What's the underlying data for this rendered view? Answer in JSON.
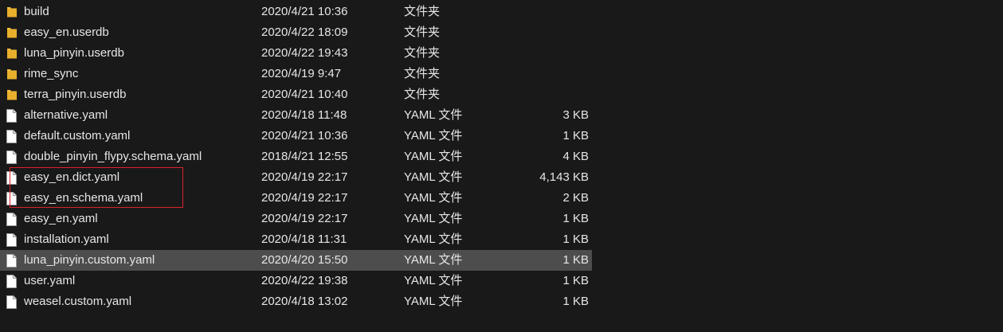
{
  "files": [
    {
      "name": "build",
      "date": "2020/4/21 10:36",
      "type": "文件夹",
      "size": "",
      "kind": "folder"
    },
    {
      "name": "easy_en.userdb",
      "date": "2020/4/22 18:09",
      "type": "文件夹",
      "size": "",
      "kind": "folder"
    },
    {
      "name": "luna_pinyin.userdb",
      "date": "2020/4/22 19:43",
      "type": "文件夹",
      "size": "",
      "kind": "folder"
    },
    {
      "name": "rime_sync",
      "date": "2020/4/19 9:47",
      "type": "文件夹",
      "size": "",
      "kind": "folder"
    },
    {
      "name": "terra_pinyin.userdb",
      "date": "2020/4/21 10:40",
      "type": "文件夹",
      "size": "",
      "kind": "folder"
    },
    {
      "name": "alternative.yaml",
      "date": "2020/4/18 11:48",
      "type": "YAML 文件",
      "size": "3 KB",
      "kind": "file"
    },
    {
      "name": "default.custom.yaml",
      "date": "2020/4/21 10:36",
      "type": "YAML 文件",
      "size": "1 KB",
      "kind": "file"
    },
    {
      "name": "double_pinyin_flypy.schema.yaml",
      "date": "2018/4/21 12:55",
      "type": "YAML 文件",
      "size": "4 KB",
      "kind": "file"
    },
    {
      "name": "easy_en.dict.yaml",
      "date": "2020/4/19 22:17",
      "type": "YAML 文件",
      "size": "4,143 KB",
      "kind": "file"
    },
    {
      "name": "easy_en.schema.yaml",
      "date": "2020/4/19 22:17",
      "type": "YAML 文件",
      "size": "2 KB",
      "kind": "file"
    },
    {
      "name": "easy_en.yaml",
      "date": "2020/4/19 22:17",
      "type": "YAML 文件",
      "size": "1 KB",
      "kind": "file"
    },
    {
      "name": "installation.yaml",
      "date": "2020/4/18 11:31",
      "type": "YAML 文件",
      "size": "1 KB",
      "kind": "file"
    },
    {
      "name": "luna_pinyin.custom.yaml",
      "date": "2020/4/20 15:50",
      "type": "YAML 文件",
      "size": "1 KB",
      "kind": "file",
      "selected": true
    },
    {
      "name": "user.yaml",
      "date": "2020/4/22 19:38",
      "type": "YAML 文件",
      "size": "1 KB",
      "kind": "file"
    },
    {
      "name": "weasel.custom.yaml",
      "date": "2020/4/18 13:02",
      "type": "YAML 文件",
      "size": "1 KB",
      "kind": "file"
    }
  ],
  "colors": {
    "background": "#191919",
    "text": "#e6e6e6",
    "selected_row": "#4d4d4d",
    "folder": "#f4c23e",
    "file": "#ffffff",
    "highlight_box": "#d8232a"
  },
  "icons": {
    "folder": "folder-icon",
    "file": "file-icon"
  }
}
